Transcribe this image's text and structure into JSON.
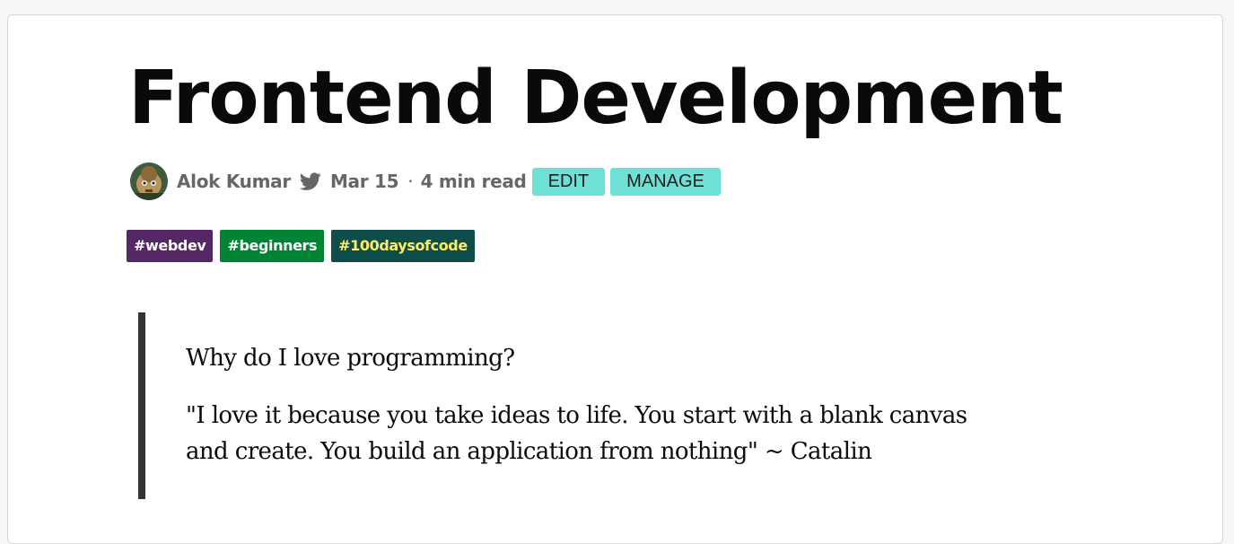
{
  "article": {
    "title": "Frontend Development",
    "author": "Alok Kumar",
    "date": "Mar 15",
    "separator": "·",
    "read_time": "4 min read",
    "edit_label": "EDIT",
    "manage_label": "MANAGE",
    "tags": [
      {
        "label": "#webdev",
        "bg": "#562765",
        "fg": "#ffffff"
      },
      {
        "label": "#beginners",
        "bg": "#008335",
        "fg": "#ffffff"
      },
      {
        "label": "#100daysofcode",
        "bg": "#0f4d4a",
        "fg": "#ffec66"
      }
    ],
    "quote": {
      "question": "Why do I love programming?",
      "line1": "\"I love it because you take ideas to life. You start with a blank canvas",
      "line2": "and create. You build an application from nothing\" ~ Catalin"
    }
  },
  "icons": {
    "twitter": "twitter-icon",
    "avatar": "author-avatar"
  },
  "colors": {
    "button": "#6ee0d6",
    "meta_text": "#666666",
    "quote_bar": "#333333"
  }
}
